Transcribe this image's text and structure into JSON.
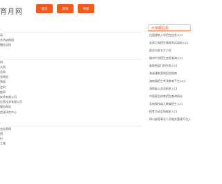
{
  "site": {
    "logo_text": "育月网"
  },
  "nav": {
    "buttons": [
      "首页",
      "资讯",
      "导航"
    ]
  },
  "left": {
    "groups": [
      {
        "items": [
          "",
          "局",
          "艺术幼稚园",
          "",
          "播社区网"
        ]
      },
      {
        "items": [
          "",
          "网",
          "大网",
          "员网",
          "",
          "会网站",
          "频道",
          "",
          "会网",
          "能网",
          "技术有限公司",
          "信息技术有限公司",
          "",
          "服务网站",
          "信息研究中心"
        ]
      },
      {
        "items": [
          "",
          "",
          "",
          "会信息网",
          "",
          "园",
          "",
          "",
          "行",
          "",
          "之城"
        ]
      }
    ]
  },
  "right": {
    "title": "大家都在看",
    "items": [
      "白银建筑入学招生信息入口",
      "云南工商招生教育考试局网入口",
      "固总分部五大小学",
      "福州中学招生信息查询入口",
      "秦保密部门招生网入口",
      "海诚建筑案例招生指南",
      "海南省招生考试教育平台入口",
      "海南省公务员报名入口",
      "中国养生体育招生查询网站",
      "云南院校幼儿教育招生入口",
      "招考活动会场报名入口",
      "四川省直事业人员服务管理平台入口"
    ]
  }
}
